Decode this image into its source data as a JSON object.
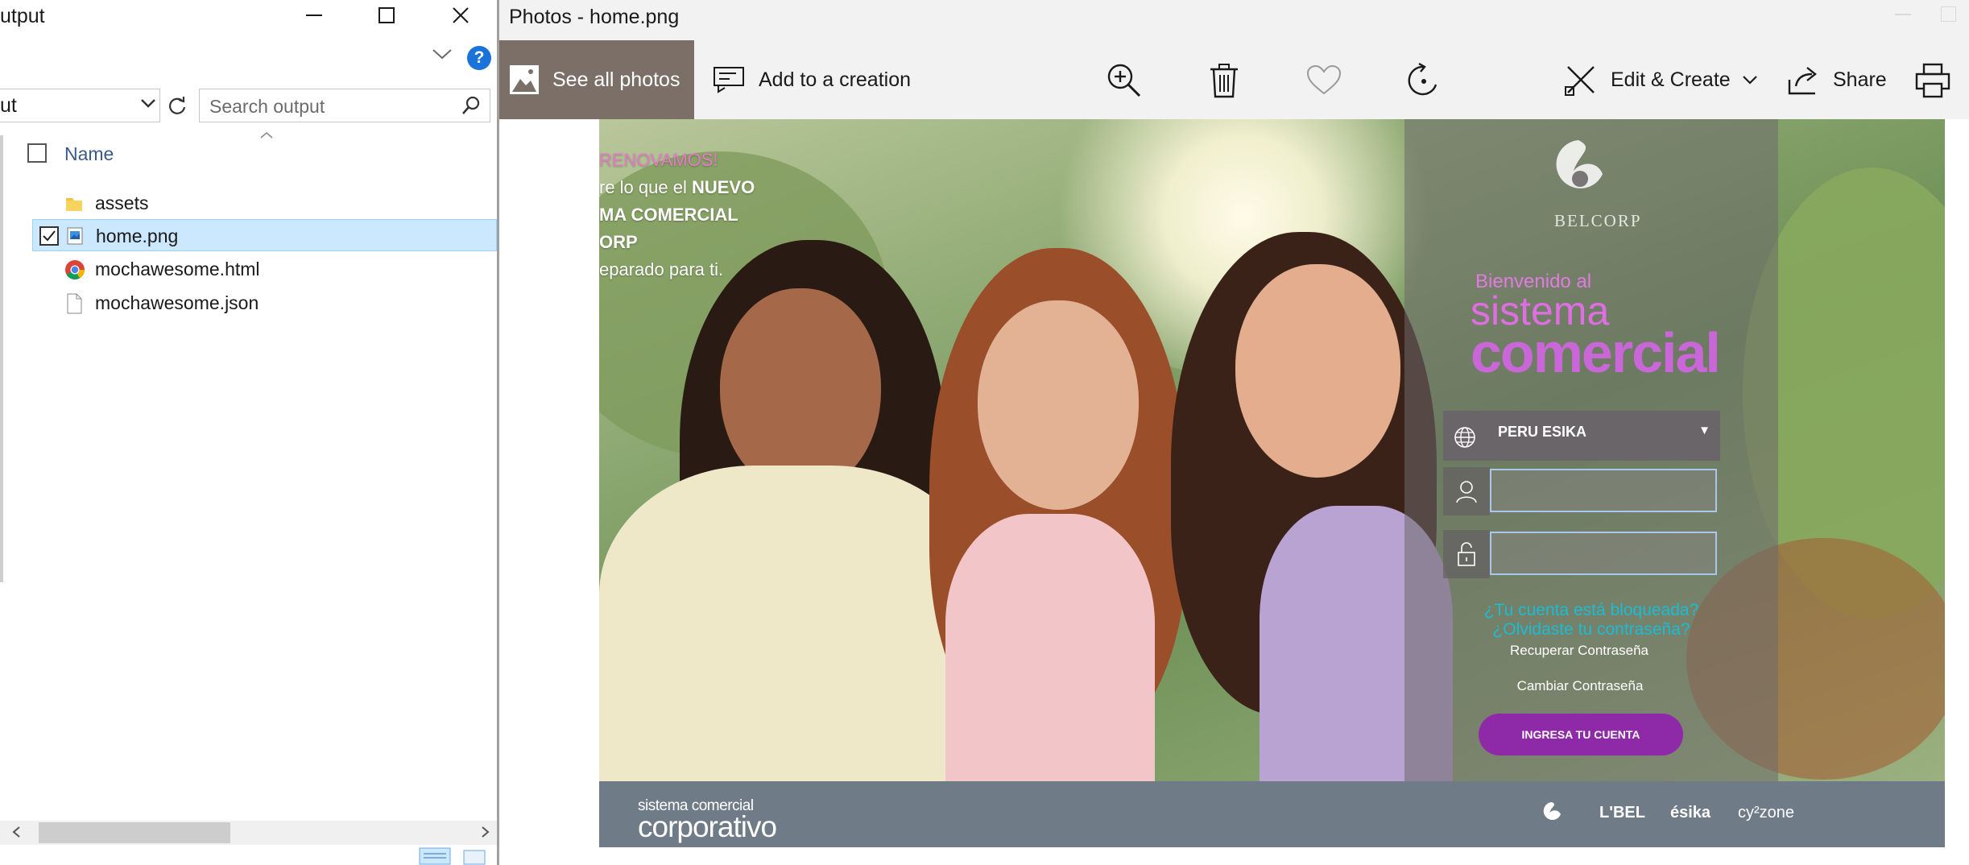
{
  "explorer": {
    "title_partial": "utput",
    "address_partial": "ut",
    "search_placeholder": "Search output",
    "column_name": "Name",
    "files": [
      {
        "name": "assets",
        "icon": "folder-icon",
        "selected": false
      },
      {
        "name": "home.png",
        "icon": "image-file-icon",
        "selected": true
      },
      {
        "name": "mochawesome.html",
        "icon": "chrome-icon",
        "selected": false
      },
      {
        "name": "mochawesome.json",
        "icon": "file-icon",
        "selected": false
      }
    ]
  },
  "photos": {
    "title": "Photos - home.png",
    "toolbar": {
      "see_all": "See all photos",
      "add_creation": "Add to a creation",
      "edit_create": "Edit & Create",
      "share": "Share"
    }
  },
  "image": {
    "ad": {
      "line1": "RENOVAMOS!",
      "line2_pre": "re lo que el ",
      "line2_bold": "NUEVO",
      "line3": "MA COMERCIAL",
      "line4": "ORP",
      "line5": "eparado para ti."
    },
    "brand": "BELCORP",
    "welcome": "Bienvenido al",
    "sistema": "sistema",
    "comercial": "comercial",
    "country": "PERU ESIKA",
    "forgot_user": "¿Tu cuenta está bloqueada?",
    "forgot_pass": "¿Olvidaste tu contraseña?",
    "recover": "Recuperar Contraseña",
    "change": "Cambiar Contraseña",
    "login_button": "INGRESA TU CUENTA",
    "footer_small": "sistema comercial",
    "footer_big": "corporativo",
    "brands": [
      "L'BEL",
      "ésika",
      "cy²zone"
    ]
  },
  "colors": {
    "see_all_bg": "#7b6f68",
    "selection": "#cce8ff",
    "login_button": "#8e2aa8",
    "footer": "#6f7b86",
    "accent_pink": "#df6ee2",
    "link_teal": "#1abcd6"
  }
}
